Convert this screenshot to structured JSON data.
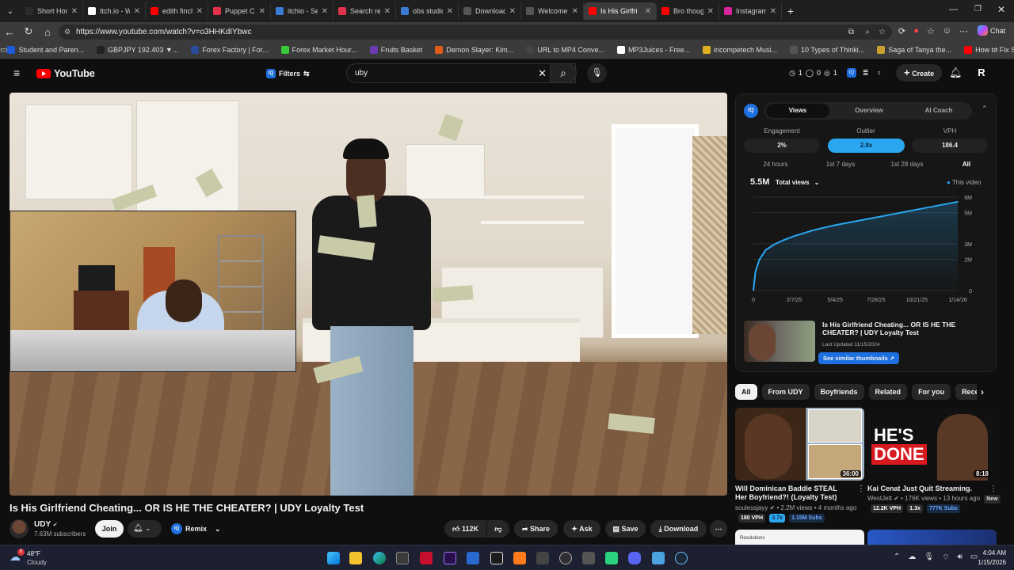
{
  "browser": {
    "tabs": [
      {
        "label": "Short Horror Ga",
        "fav_color": "#2b2b2b"
      },
      {
        "label": "Itch.io - Wikipe",
        "fav_color": "#ffffff"
      },
      {
        "label": "edith finch - Yo",
        "fav_color": "#ff0000"
      },
      {
        "label": "Puppet Combo",
        "fav_color": "#e0334b"
      },
      {
        "label": "itchio - Search",
        "fav_color": "#3a7bd5"
      },
      {
        "label": "Search results",
        "fav_color": "#e0334b"
      },
      {
        "label": "obs studio - Se",
        "fav_color": "#3a7bd5"
      },
      {
        "label": "Download | OB",
        "fav_color": "#555555"
      },
      {
        "label": "Welcome | OBS",
        "fav_color": "#555555"
      },
      {
        "label": "Is His Girlfri",
        "fav_color": "#ff0000"
      },
      {
        "label": "Bro thought he",
        "fav_color": "#ff0000"
      },
      {
        "label": "Instagram",
        "fav_color": "#d6249f"
      }
    ],
    "url": "https://www.youtube.com/watch?v=o3HHKdIYbwc",
    "bookmarks": [
      {
        "label": "Student and Paren...",
        "color": "#1e5bd8"
      },
      {
        "label": "GBPJPY 192.403 ▼...",
        "color": "#222222"
      },
      {
        "label": "Forex Factory | For...",
        "color": "#2a4a9a"
      },
      {
        "label": "Forex Market Hour...",
        "color": "#39c939"
      },
      {
        "label": "Fruits Basket",
        "color": "#6a3ab0"
      },
      {
        "label": "Demon Slayer: Kim...",
        "color": "#e05a1a"
      },
      {
        "label": "URL to MP4 Conve...",
        "color": "#444444"
      },
      {
        "label": "MP3Juices - Free...",
        "color": "#ffffff"
      },
      {
        "label": "incompetech Musi...",
        "color": "#e0b020"
      },
      {
        "label": "10 Types of Thinki...",
        "color": "#555555"
      },
      {
        "label": "Saga of Tanya the...",
        "color": "#c9a030"
      },
      {
        "label": "How to Fix Screen...",
        "color": "#ff0000"
      }
    ],
    "chat_label": "Chat"
  },
  "youtube": {
    "logo_text": "YouTube",
    "filters_label": "Filters",
    "search_value": "uby",
    "stats": {
      "a": "1",
      "b": "0",
      "c": "1"
    },
    "create_label": "Create",
    "avatar_letter": "R"
  },
  "iq": {
    "tabs": [
      "Views",
      "Overview",
      "AI Coach"
    ],
    "metrics": [
      {
        "label": "Engagement",
        "value": "2%"
      },
      {
        "label": "Outlier",
        "value": "2.8x"
      },
      {
        "label": "VPH",
        "value": "186.4"
      }
    ],
    "ranges": [
      "24 hours",
      "1st 7 days",
      "1st 28 days",
      "All"
    ],
    "total": "5.5M",
    "total_label": "Total views",
    "legend": "This video",
    "related_title": "Is His Girlfriend Cheating... OR IS HE THE CHEATER? | UDY Loyalty Test",
    "related_updated": "Last Updated 11/15/2024",
    "similar_btn": "See similar thumbnails"
  },
  "chart_data": {
    "type": "area",
    "x_ticks": [
      "0",
      "2/7/25",
      "5/4/25",
      "7/28/25",
      "10/21/25",
      "1/14/26"
    ],
    "y_ticks": [
      "0",
      "2M",
      "3M",
      "5M",
      "6M"
    ],
    "ylim": [
      0,
      6000000
    ],
    "x_frac": [
      0,
      0.01,
      0.03,
      0.06,
      0.1,
      0.15,
      0.2,
      0.3,
      0.4,
      0.5,
      0.6,
      0.7,
      0.8,
      0.9,
      1.0
    ],
    "values": [
      0,
      1200000,
      2000000,
      2600000,
      2950000,
      3250000,
      3500000,
      3900000,
      4200000,
      4450000,
      4700000,
      4950000,
      5200000,
      5450000,
      5700000
    ],
    "grid": true,
    "legend": "top-right"
  },
  "chips": [
    "All",
    "From UDY",
    "Boyfriends",
    "Related",
    "For you",
    "Recently uplo"
  ],
  "recs": [
    {
      "title": "Will Dominican Baddie STEAL Her Boyfriend?! (Loyalty Test)",
      "channel": "soulessjayy",
      "meta": "2.2M views • 4 months ago",
      "duration": "36:00",
      "b1": "180 VPH",
      "b2": "3.7x",
      "b3": "1.15M Subs"
    },
    {
      "title": "Kai Cenat Just Quit Streaming.",
      "channel": "WestJett",
      "meta": "176K views • 13 hours ago",
      "badge_new": "New",
      "duration": "8:18",
      "b1": "12.2K VPH",
      "b2": "1.3x",
      "b3": "777K Subs",
      "thumb_text_1": "HE'S",
      "thumb_text_2": "DONE"
    }
  ],
  "next_rec": {
    "snippet": "Resolutions"
  },
  "video": {
    "title": "Is His Girlfriend Cheating... OR IS HE THE CHEATER? | UDY Loyalty Test",
    "channel": "UDY",
    "subscribers": "7.63M subscribers",
    "join_label": "Join",
    "remix_label": "Remix",
    "likes": "112K",
    "share_label": "Share",
    "ask_label": "Ask",
    "save_label": "Save",
    "download_label": "Download"
  },
  "taskbar": {
    "temp": "48°F",
    "weather": "Cloudy",
    "weather_badge": "8",
    "time": "4:04 AM",
    "date": "1/15/2026"
  }
}
